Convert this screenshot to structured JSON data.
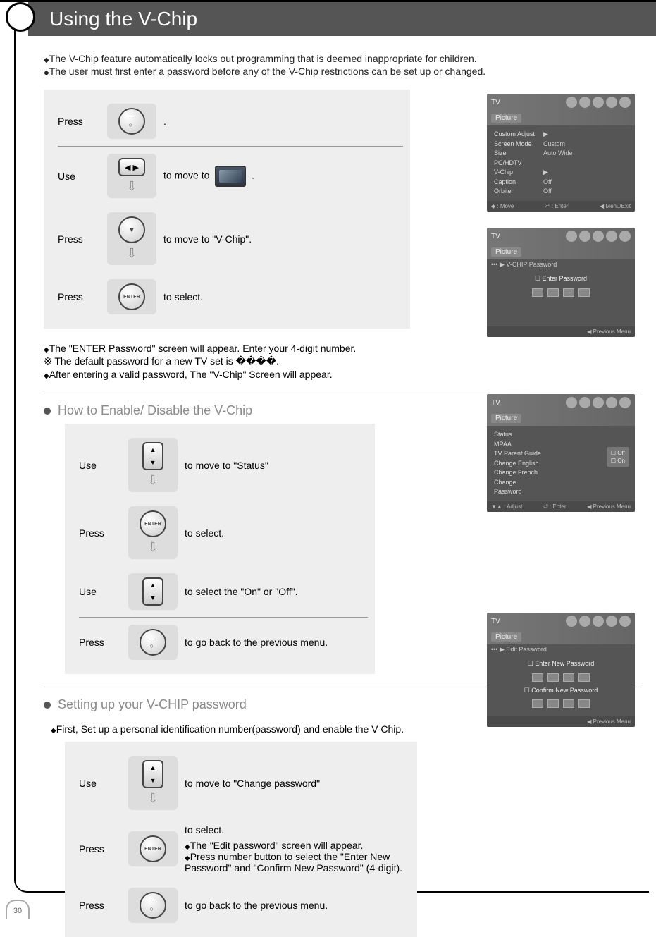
{
  "page_number": "30",
  "title": "Using the V-Chip",
  "intro": {
    "line1": "The V-Chip feature automatically locks out programming that is deemed inappropriate for children.",
    "line2": "The user must first enter a password before any of the V-Chip restrictions can be set up or changed."
  },
  "steps1": {
    "r1_action": "Press",
    "r1_desc": ".",
    "r2_action": "Use",
    "r2_desc_pre": "to move to",
    "r2_desc_post": ".",
    "r3_action": "Press",
    "r3_desc": "to move to \"V-Chip\".",
    "r4_action": "Press",
    "r4_desc": "to select.",
    "enter_label": "ENTER"
  },
  "pw_note": {
    "line1": "The \"ENTER Password\" screen will appear. Enter your 4-digit number.",
    "line2": "※  The default password for a new TV set is ����.",
    "line3": "After entering a valid password, The \"V-Chip\" Screen will appear."
  },
  "section2_title": "How to Enable/ Disable the V-Chip",
  "steps2": {
    "r1_action": "Use",
    "r1_desc": "to move to \"Status\"",
    "r2_action": "Press",
    "r2_desc": "to select.",
    "r3_action": "Use",
    "r3_desc": "to select the \"On\" or \"Off\".",
    "r4_action": "Press",
    "r4_desc": "to go back to the previous menu.",
    "enter_label": "ENTER"
  },
  "section3_title": "Setting up your V-CHIP password",
  "section3_note": "First, Set up a personal identification number(password) and enable the V-Chip.",
  "steps3": {
    "r1_action": "Use",
    "r1_desc": "to move to \"Change password\"",
    "r2_action": "Press",
    "r2_desc": "to select.",
    "r2_sub1": "The \"Edit password\" screen will appear.",
    "r2_sub2": "Press number button to select the \"Enter New Password\" and \"Confirm New Password\" (4-digit).",
    "r3_action": "Press",
    "r3_desc": "to go back to the previous menu.",
    "enter_label": "ENTER"
  },
  "osd1": {
    "tab": "TV",
    "title": "Picture",
    "rows": [
      {
        "k": "Custom Adjust",
        "v": "▶"
      },
      {
        "k": "Screen Mode",
        "v": "Custom"
      },
      {
        "k": "Size",
        "v": "Auto Wide"
      },
      {
        "k": "PC/HDTV",
        "v": "",
        "dim": true
      },
      {
        "k": "V-Chip",
        "v": "▶"
      },
      {
        "k": "Caption",
        "v": "Off"
      },
      {
        "k": "Orbiter",
        "v": "Off"
      }
    ],
    "foot": {
      "l": "◆ : Move",
      "c": "⏎ : Enter",
      "r": "◀ Menu/Exit"
    }
  },
  "osd2": {
    "tab": "TV",
    "title": "Picture",
    "crumb": "••• ▶ V-CHIP Password",
    "label": "☐ Enter Password",
    "foot_r": "◀ Previous Menu"
  },
  "osd3": {
    "tab": "TV",
    "title": "Picture",
    "rows": [
      {
        "k": "Status",
        "v": ""
      },
      {
        "k": "MPAA",
        "v": "",
        "dim": true
      },
      {
        "k": "TV Parent Guide",
        "v": "",
        "dim": true
      },
      {
        "k": "Change English",
        "v": "",
        "dim": true
      },
      {
        "k": "Change French",
        "v": "",
        "dim": true
      },
      {
        "k": "Change Password",
        "v": "",
        "dim": true
      }
    ],
    "popup": {
      "opt1": "☐ Off",
      "opt2": "☐ On"
    },
    "foot": {
      "l": "▼▲ : Adjust",
      "c": "⏎ : Enter",
      "r": "◀ Previous Menu"
    }
  },
  "osd4": {
    "tab": "TV",
    "title": "Picture",
    "crumb": "••• ▶ Edit Password",
    "label1": "☐ Enter New Password",
    "label2": "☐ Confirm New Password",
    "foot_r": "◀ Previous Menu"
  }
}
